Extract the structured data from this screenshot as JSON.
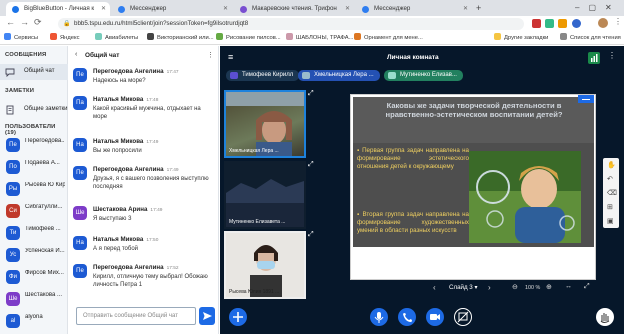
{
  "browser": {
    "tabs": [
      {
        "label": "BigBlueButton - Личная к",
        "active": true,
        "color": "#1a73e8"
      },
      {
        "label": "Мессенджер",
        "active": false,
        "color": "#2e7df0"
      },
      {
        "label": "Макаревские чтения. Трифон",
        "active": false,
        "color": "#7a4fd1"
      },
      {
        "label": "Мессенджер",
        "active": false,
        "color": "#2e7df0"
      }
    ],
    "new_tab": "+",
    "url": "bbb5.tspu.edu.ru/html5client/join?sessionToken=fg9ilsotrurdjqt8",
    "bookmarks": [
      "Сервисы",
      "Яндекс",
      "Авиабилеты",
      "Викторианский или...",
      "Рисование пилсов...",
      "ШАБЛОНЫ, ТРАФА...",
      "Орнамент для мене...",
      "Другие закладки",
      "Список для чтения"
    ]
  },
  "sidebar": {
    "messages_title": "СООБЩЕНИЯ",
    "public_chat": "Общий чат",
    "notes_title": "ЗАМЕТКИ",
    "shared_notes": "Общие заметки",
    "users_title": "ПОЛЬЗОВАТЕЛИ (19)",
    "users": [
      {
        "initials": "Пе",
        "name": "Перегоедова...",
        "color": "#1d5ad3"
      },
      {
        "initials": "По",
        "name": "Подаева А...",
        "color": "#1d5ad3"
      },
      {
        "initials": "Ры",
        "name": "Рысева Ю Кирилл...",
        "color": "#1d5ad3"
      },
      {
        "initials": "Си",
        "name": "Сибгатулли...",
        "color": "#c0392b"
      },
      {
        "initials": "Ти",
        "name": "Тимофеев ...",
        "color": "#1d5ad3"
      },
      {
        "initials": "Ус",
        "name": "Успенская И...",
        "color": "#1d5ad3"
      },
      {
        "initials": "Фи",
        "name": "Фирсов Мих...",
        "color": "#1d5ad3"
      },
      {
        "initials": "Ше",
        "name": "Шестакова ...",
        "color": "#7d3cc8"
      },
      {
        "initials": "al",
        "name": "alyona",
        "color": "#1d5ad3"
      }
    ]
  },
  "chat": {
    "back_label": "Общий чат",
    "messages": [
      {
        "initials": "Пе",
        "name": "Перегоедова Ангелина",
        "time": "17:47",
        "text": "Надеюсь на море?"
      },
      {
        "initials": "Па",
        "name": "Наталья Микова",
        "time": "17:48",
        "text": "Какой красивый мужчина, отдыхает на море"
      },
      {
        "initials": "На",
        "name": "Наталья Микова",
        "time": "17:49",
        "text": "Вы же попросили"
      },
      {
        "initials": "Пе",
        "name": "Перегоедова Ангелина",
        "time": "17:49",
        "text": "Друзья, я с вашего позволения выступлю последняя"
      },
      {
        "initials": "Ше",
        "name": "Шестакова Арина",
        "time": "17:49",
        "text": "Я выступаю 3"
      },
      {
        "initials": "На",
        "name": "Наталья Микова",
        "time": "17:50",
        "text": "А я перед тобой"
      },
      {
        "initials": "Пе",
        "name": "Перегоедова Ангелина",
        "time": "17:52",
        "text": "Кирилл, отличную тему выбрал! Обожаю личность Петра 1"
      }
    ],
    "input_placeholder": "Отправить сообщение Общий чат"
  },
  "room": {
    "title": "Личная комната",
    "talking": [
      {
        "name": "Тимофеев Кирилл",
        "color": "#5b4fd1"
      },
      {
        "name": "Хмельницкая Лера ...",
        "color": "#1d5ad3"
      },
      {
        "name": "Мутиненко Елизав...",
        "color": "#2aa874"
      }
    ],
    "videos": [
      "Хмельницкая Лера ...",
      "Мутиненко Елизавета ...",
      "Рысева Юлия 1891 ..."
    ]
  },
  "slide": {
    "heading": "Каковы же задачи творческой деятельности в нравственно-эстетическом воспитании детей?",
    "point1": "Первая группа задач направлена на формирование эстетического отношения детей к окружающему",
    "point2": "Вторая группа задач направлена на формирование художественных умений в области разных искусств",
    "slide_label": "Слайд 3",
    "zoom": "100 %"
  }
}
